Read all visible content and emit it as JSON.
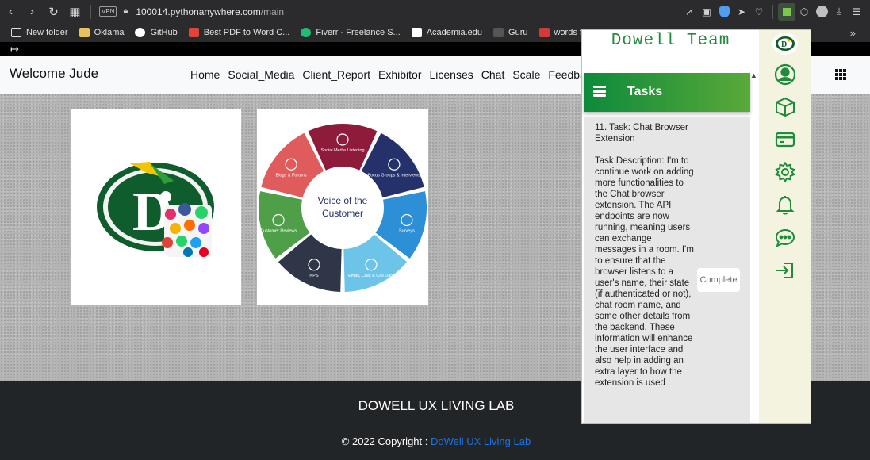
{
  "browser": {
    "vpn_label": "VPN",
    "url_host": "100014.pythonanywhere.com",
    "url_path": "/main",
    "bookmarks": [
      {
        "label": "New folder",
        "color": "#e3e3e3"
      },
      {
        "label": "Oklama",
        "color": "#e8c25a"
      },
      {
        "label": "GitHub",
        "color": "#ffffff"
      },
      {
        "label": "Best PDF to Word C...",
        "color": "#e0453a"
      },
      {
        "label": "Fiverr - Freelance S...",
        "color": "#1dbf73"
      },
      {
        "label": "Academia.edu",
        "color": "#ffffff"
      },
      {
        "label": "Guru",
        "color": "#333333"
      },
      {
        "label": "words for people ac...",
        "color": "#d33a3a"
      }
    ],
    "bookmarks_more": "»"
  },
  "site": {
    "welcome": "Welcome Jude",
    "nav": [
      "Home",
      "Social_Media",
      "Client_Report",
      "Exhibitor",
      "Licenses",
      "Chat",
      "Scale",
      "Feedback"
    ],
    "footer_title": "DOWELL UX LIVING LAB",
    "copyright_prefix": "© 2022 Copyright : ",
    "copyright_link": "DoWell UX Living Lab"
  },
  "images": {
    "dowell_logo_letter": "D",
    "voc": {
      "center": [
        "Voice of the",
        "Customer"
      ],
      "segments": [
        "Social Media Listening",
        "Focus Groups & Interviews",
        "Surveys",
        "Email, Chat & Call Data",
        "NPS",
        "Customer Reviews",
        "Blogs & Forums"
      ],
      "colors": [
        "#8e1b3a",
        "#24316b",
        "#2d8fd6",
        "#6cc4e9",
        "#2f3647",
        "#4f9e48",
        "#e05b5b"
      ]
    }
  },
  "extension": {
    "title": "Dowell Team",
    "header": "Tasks",
    "task_title": "11. Task: Chat Browser Extension",
    "task_description": "Task Description: I'm to continue work on adding more functionalities to the Chat browser extension. The API endpoints are now running, meaning users can exchange messages in a room. I'm to ensure that the browser listens to a user's name, their state (if authenticated or not), chat room name, and some other details from the backend. These information will enhance the user interface and also help in adding an extra layer to how the extension is used",
    "complete_label": "Complete",
    "accent": "#1f8c3c"
  }
}
